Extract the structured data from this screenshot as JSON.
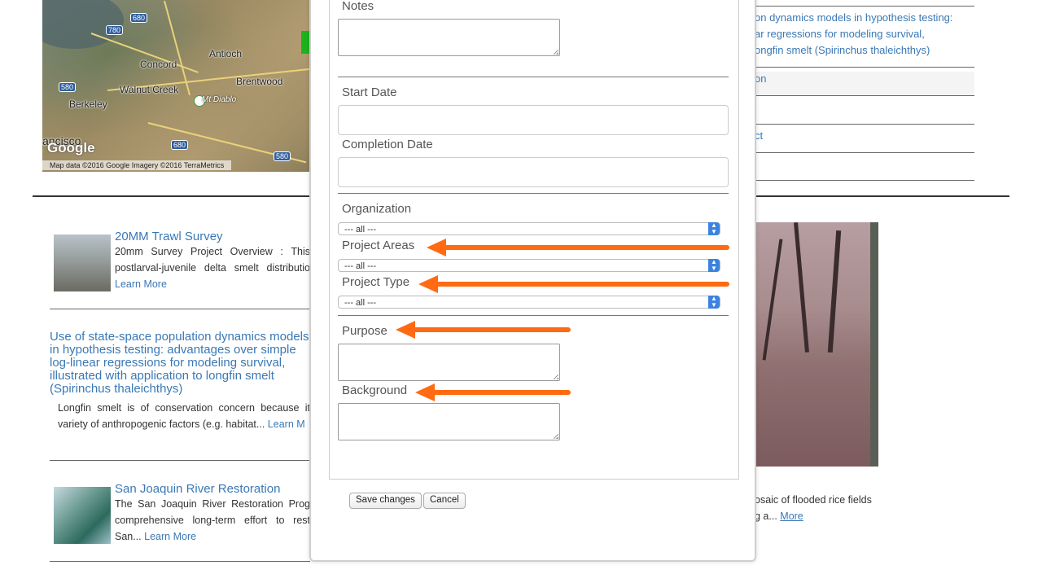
{
  "map": {
    "towns": [
      "Concord",
      "Antioch",
      "Walnut Creek",
      "Brentwood",
      "Berkeley",
      "ancisco"
    ],
    "shields": [
      "680",
      "780",
      "580",
      "680",
      "580"
    ],
    "landmark": "Mt Diablo",
    "google_logo": "Google",
    "attribution": "Map data ©2016 Google Imagery ©2016 TerraMetrics"
  },
  "projects": [
    {
      "title": "20MM Trawl Survey",
      "body": "20mm Survey Project Overview : This postlarval-juvenile delta smelt distributio",
      "more": "Learn More"
    },
    {
      "title": "Use of state-space population dynamics models in hypothesis testing: advantages over simple log-linear regressions for modeling survival, illustrated with application to longfin smelt (Spirinchus thaleichthys)",
      "body": "Longfin smelt is of conservation concern because it variety of anthropogenic factors (e.g. habitat...",
      "more": "Learn M"
    },
    {
      "title": "San Joaquin River Restoration",
      "body": "The San Joaquin River Restoration Prog comprehensive long-term effort to rest San...",
      "more": "Learn More"
    }
  ],
  "right_column": {
    "link_lines": [
      "on dynamics models in hypothesis testing:",
      "ar regressions for modeling survival,",
      "ongfin smelt (Spirinchus thaleichthys)"
    ],
    "row2": "on",
    "row4": "ct",
    "caption_line1": "osaic of flooded rice fields",
    "caption_line2": "g a...",
    "caption_more": "More"
  },
  "form": {
    "notes_label": "Notes",
    "start_date_label": "Start Date",
    "completion_date_label": "Completion Date",
    "organization_label": "Organization",
    "organization_value": "--- all ---",
    "project_areas_label": "Project Areas",
    "project_areas_value": "--- all ---",
    "project_type_label": "Project Type",
    "project_type_value": "--- all ---",
    "purpose_label": "Purpose",
    "background_label": "Background",
    "save_label": "Save changes",
    "cancel_label": "Cancel",
    "arrow_color": "#ff6a13"
  }
}
